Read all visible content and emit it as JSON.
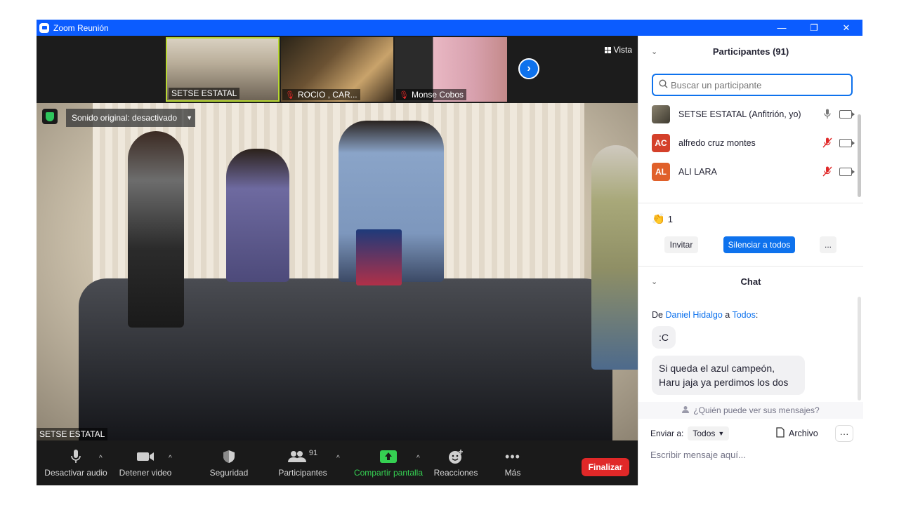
{
  "window": {
    "title": "Zoom Reunión",
    "controls": [
      "minimize",
      "restore",
      "close"
    ]
  },
  "thumbnails": [
    {
      "name": "SETSE ESTATAL",
      "muted": false,
      "active": true
    },
    {
      "name": "ROCIO , CAR...",
      "muted": true,
      "active": false
    },
    {
      "name": "Monse Cobos",
      "muted": true,
      "active": false
    }
  ],
  "view_button": {
    "label": "Vista"
  },
  "main_video": {
    "sound_banner": "Sonido original: desactivado",
    "speaker_name": "SETSE ESTATAL"
  },
  "toolbar": {
    "mute": "Desactivar audio",
    "video": "Detener video",
    "security": "Seguridad",
    "participants": "Participantes",
    "participants_count": "91",
    "share": "Compartir pantalla",
    "reactions": "Reacciones",
    "more": "Más",
    "end": "Finalizar"
  },
  "participants_panel": {
    "title": "Participantes (91)",
    "search_placeholder": "Buscar un participante",
    "list": [
      {
        "name": "SETSE ESTATAL (Anfitrión, yo)",
        "initials": "",
        "avatar_color": "#5a5a4a",
        "mic_muted": false
      },
      {
        "name": "alfredo cruz montes",
        "initials": "AC",
        "avatar_color": "#d4402a",
        "mic_muted": true
      },
      {
        "name": "ALI LARA",
        "initials": "AL",
        "avatar_color": "#e0602a",
        "mic_muted": true
      }
    ],
    "reaction_count": "1",
    "invite": "Invitar",
    "mute_all": "Silenciar a todos",
    "more": "..."
  },
  "chat_panel": {
    "title": "Chat",
    "from_prefix": "De",
    "from_name": "Daniel Hidalgo",
    "to_word": "a",
    "to_name": "Todos",
    "messages": [
      ":C",
      "Si queda el azul campeón,",
      "Haru jaja ya perdimos los dos"
    ],
    "privacy_note": "¿Quién puede ver sus mensajes?",
    "send_to_label": "Enviar a:",
    "send_to_value": "Todos",
    "file": "Archivo",
    "input_placeholder": "Escribir mensaje aquí..."
  },
  "colors": {
    "titlebar": "#0b5cff",
    "accent": "#0e72ed",
    "end": "#e02828",
    "share_green": "#35d052"
  }
}
